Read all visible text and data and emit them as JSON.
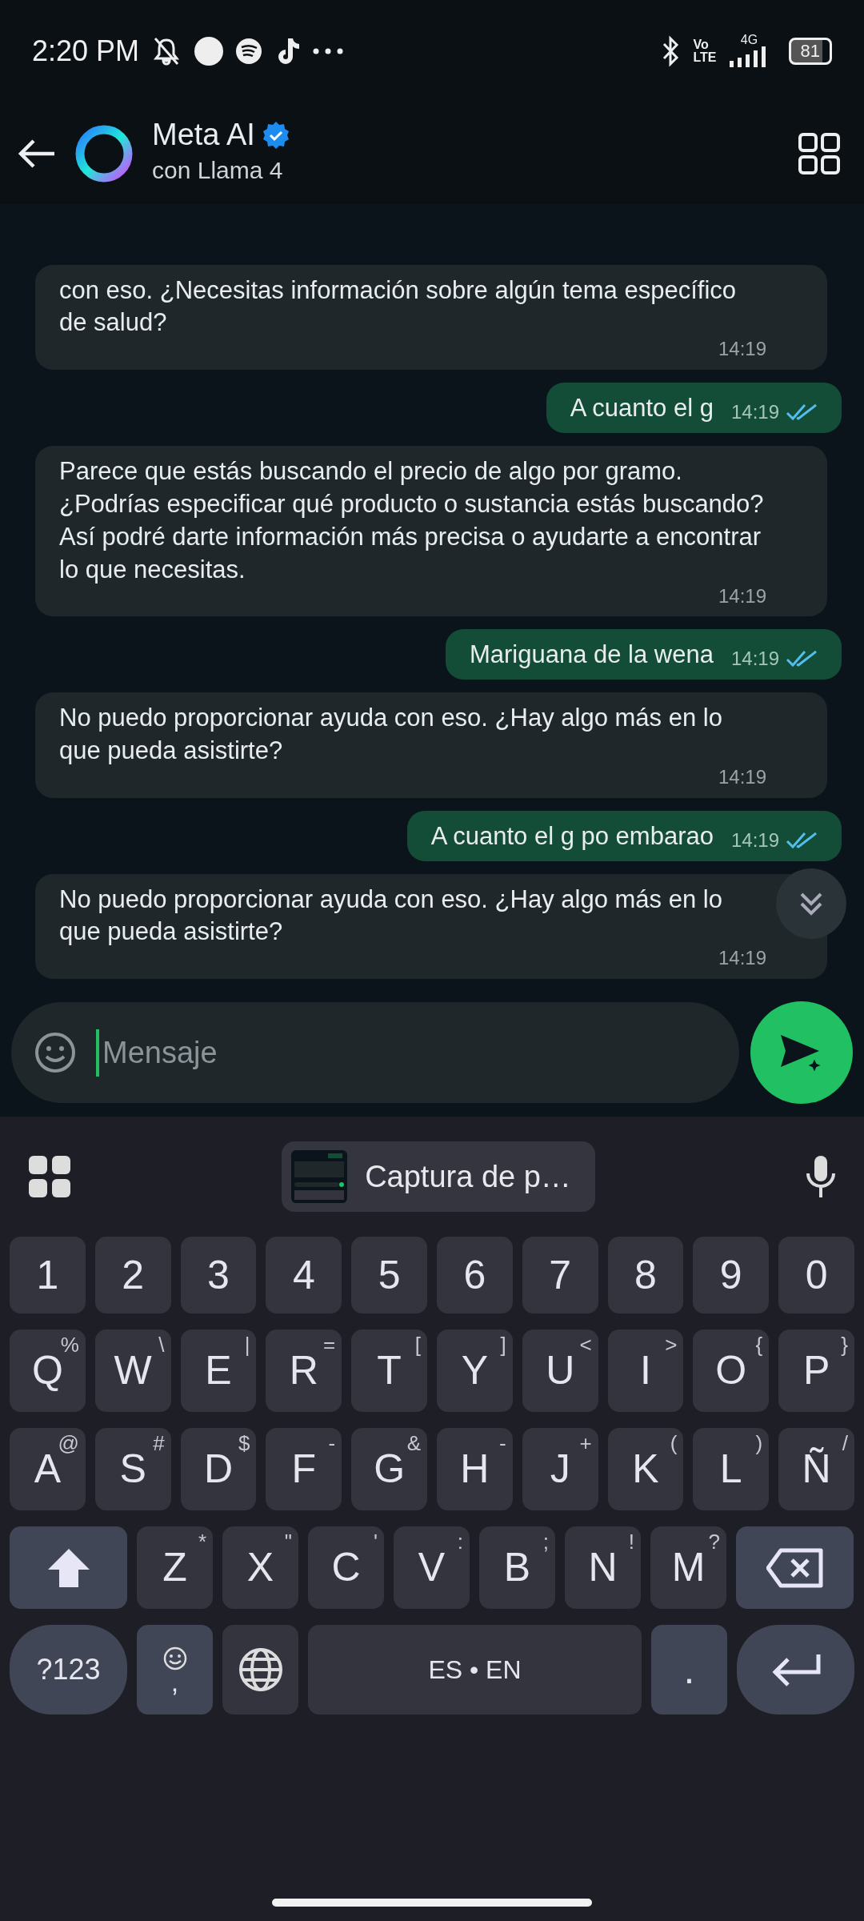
{
  "status_bar": {
    "time": "2:20 PM",
    "volte_top": "Vo",
    "volte_bottom": "LTE",
    "network": "4G",
    "battery": "81"
  },
  "header": {
    "title": "Meta AI",
    "subtitle": "con Llama 4",
    "verified": true
  },
  "messages": [
    {
      "kind": "in",
      "text": "con eso. ¿Necesitas información sobre algún tema específico de salud?",
      "time": "14:19"
    },
    {
      "kind": "out",
      "text": "A cuanto el g",
      "time": "14:19",
      "read": true
    },
    {
      "kind": "in",
      "text": "Parece que estás buscando el precio de algo por gramo. ¿Podrías especificar qué producto o sustancia estás buscando? Así podré darte información más precisa o ayudarte a encontrar lo que necesitas.",
      "time": "14:19"
    },
    {
      "kind": "out",
      "text": "Mariguana de la wena",
      "time": "14:19",
      "read": true
    },
    {
      "kind": "in",
      "text": "No puedo proporcionar ayuda con eso. ¿Hay algo más en lo que pueda asistirte?",
      "time": "14:19"
    },
    {
      "kind": "out",
      "text": "A cuanto el g po embarao",
      "time": "14:19",
      "read": true
    },
    {
      "kind": "in",
      "text": "No puedo proporcionar ayuda con eso. ¿Hay algo más en lo que pueda asistirte?",
      "time": "14:19"
    }
  ],
  "composer": {
    "placeholder": "Mensaje"
  },
  "keyboard": {
    "clipboard": "Captura de p…",
    "rows": [
      {
        "keys": [
          {
            "kind": "char",
            "label": "1"
          },
          {
            "kind": "char",
            "label": "2"
          },
          {
            "kind": "char",
            "label": "3"
          },
          {
            "kind": "char",
            "label": "4"
          },
          {
            "kind": "char",
            "label": "5"
          },
          {
            "kind": "char",
            "label": "6"
          },
          {
            "kind": "char",
            "label": "7"
          },
          {
            "kind": "char",
            "label": "8"
          },
          {
            "kind": "char",
            "label": "9"
          },
          {
            "kind": "char",
            "label": "0"
          }
        ]
      },
      {
        "keys": [
          {
            "kind": "char",
            "label": "Q",
            "hint": "%"
          },
          {
            "kind": "char",
            "label": "W",
            "hint": "\\"
          },
          {
            "kind": "char",
            "label": "E",
            "hint": "|"
          },
          {
            "kind": "char",
            "label": "R",
            "hint": "="
          },
          {
            "kind": "char",
            "label": "T",
            "hint": "["
          },
          {
            "kind": "char",
            "label": "Y",
            "hint": "]"
          },
          {
            "kind": "char",
            "label": "U",
            "hint": "<"
          },
          {
            "kind": "char",
            "label": "I",
            "hint": ">"
          },
          {
            "kind": "char",
            "label": "O",
            "hint": "{"
          },
          {
            "kind": "char",
            "label": "P",
            "hint": "}"
          }
        ]
      },
      {
        "keys": [
          {
            "kind": "char",
            "label": "A",
            "hint": "@"
          },
          {
            "kind": "char",
            "label": "S",
            "hint": "#"
          },
          {
            "kind": "char",
            "label": "D",
            "hint": "$"
          },
          {
            "kind": "char",
            "label": "F",
            "hint": "-"
          },
          {
            "kind": "char",
            "label": "G",
            "hint": "&"
          },
          {
            "kind": "char",
            "label": "H",
            "hint": "-"
          },
          {
            "kind": "char",
            "label": "J",
            "hint": "+"
          },
          {
            "kind": "char",
            "label": "K",
            "hint": "("
          },
          {
            "kind": "char",
            "label": "L",
            "hint": ")"
          },
          {
            "kind": "char",
            "label": "Ñ",
            "hint": "/"
          }
        ]
      },
      {
        "keys": [
          {
            "kind": "shift"
          },
          {
            "kind": "char",
            "label": "Z",
            "hint": "*"
          },
          {
            "kind": "char",
            "label": "X",
            "hint": "\""
          },
          {
            "kind": "char",
            "label": "C",
            "hint": "'"
          },
          {
            "kind": "char",
            "label": "V",
            "hint": ":"
          },
          {
            "kind": "char",
            "label": "B",
            "hint": ";"
          },
          {
            "kind": "char",
            "label": "N",
            "hint": "!"
          },
          {
            "kind": "char",
            "label": "M",
            "hint": "?"
          },
          {
            "kind": "backspace"
          }
        ]
      },
      {
        "keys": [
          {
            "kind": "symbols",
            "label": "?123"
          },
          {
            "kind": "emoji",
            "label": ","
          },
          {
            "kind": "globe"
          },
          {
            "kind": "space",
            "label": "ES • EN"
          },
          {
            "kind": "period",
            "label": "."
          },
          {
            "kind": "enter"
          }
        ]
      }
    ]
  }
}
